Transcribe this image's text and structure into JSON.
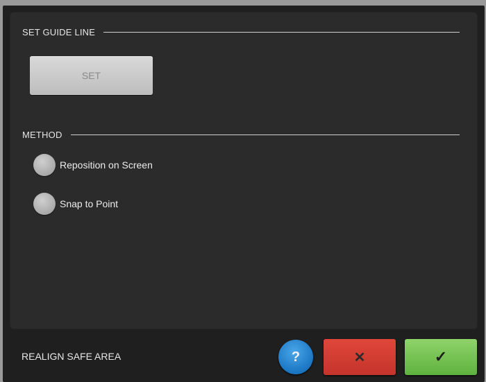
{
  "dialog": {
    "set_guide_line": {
      "header": "SET GUIDE LINE",
      "set_button_label": "SET"
    },
    "method": {
      "header": "METHOD",
      "options": [
        {
          "label": "Reposition on Screen",
          "selected": false
        },
        {
          "label": "Snap to Point",
          "selected": false
        }
      ]
    },
    "footer": {
      "title": "REALIGN SAFE AREA",
      "help_symbol": "?",
      "cancel_symbol": "✕",
      "ok_symbol": "✓"
    }
  },
  "colors": {
    "help": "#1e79c6",
    "cancel": "#d13d31",
    "ok": "#7cc455"
  },
  "icons": [
    "question-mark-icon",
    "close-icon",
    "checkmark-icon",
    "radio-icon"
  ]
}
